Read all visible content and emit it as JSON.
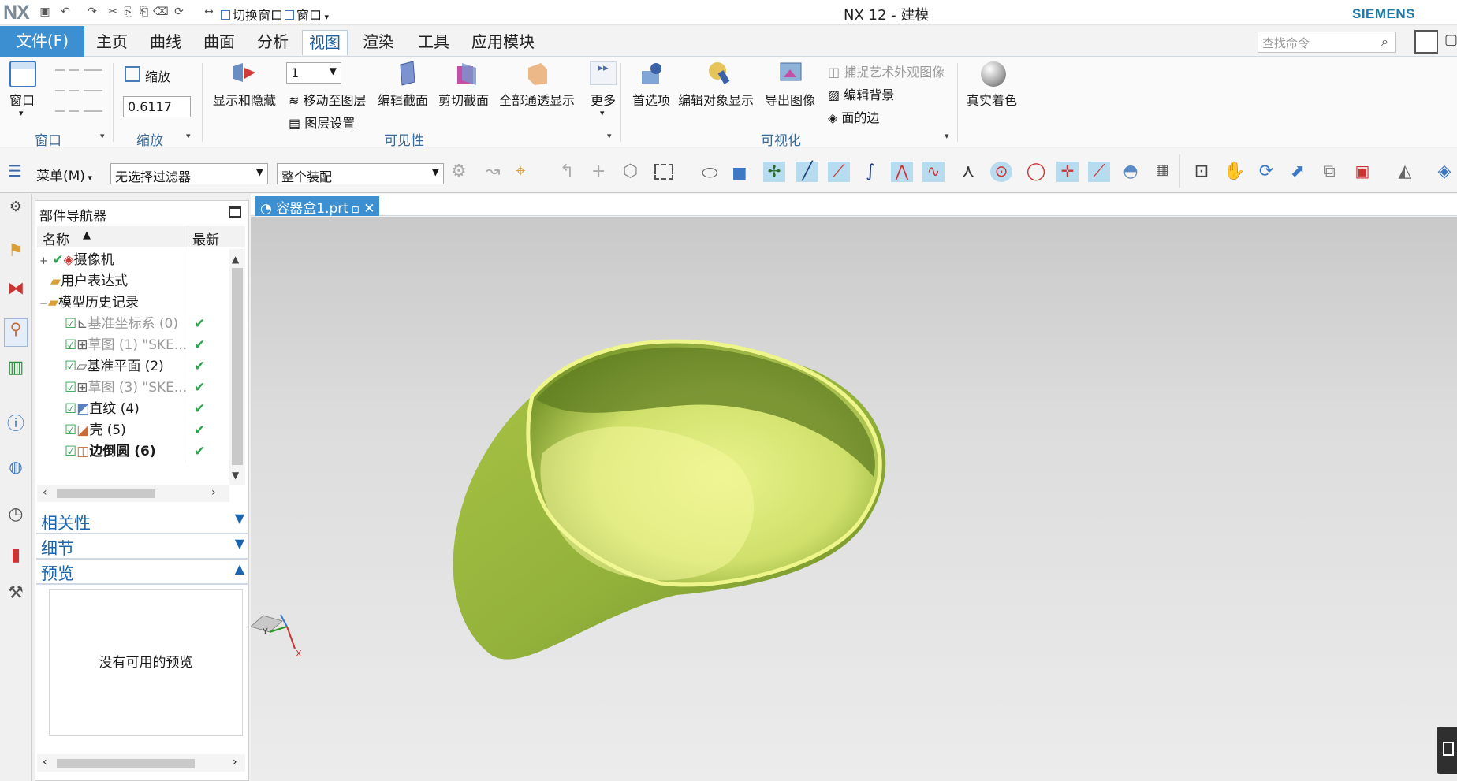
{
  "titlebar": {
    "logo": "NX",
    "title": "NX 12 - 建模",
    "brand": "SIEMENS",
    "switch_window": "切换窗口",
    "window_menu": "窗口"
  },
  "menu": {
    "file": "文件(F)",
    "tabs": [
      "主页",
      "曲线",
      "曲面",
      "分析",
      "视图",
      "渲染",
      "工具",
      "应用模块"
    ],
    "active_tab": "视图",
    "search_placeholder": "查找命令"
  },
  "ribbon": {
    "window": {
      "label": "窗口",
      "group": "窗口"
    },
    "zoom": {
      "label": "缩放",
      "value": "0.6117",
      "group": "缩放"
    },
    "visibility": {
      "show_hide": "显示和隐藏",
      "layer_value": "1",
      "move_to_layer": "移动至图层",
      "layer_settings": "图层设置",
      "edit_section": "编辑截面",
      "clip_section": "剪切截面",
      "all_see_through": "全部通透显示",
      "more": "更多",
      "group": "可见性"
    },
    "visualization": {
      "preferences": "首选项",
      "edit_object_display": "编辑对象显示",
      "export_image": "导出图像",
      "capture_art": "捕捉艺术外观图像",
      "edit_background": "编辑背景",
      "face_edges": "面的边",
      "group": "可视化"
    },
    "true_shading": "真实着色"
  },
  "toolbar": {
    "menu": "菜单(M)",
    "filter": "无选择过滤器",
    "scope": "整个装配"
  },
  "navigator": {
    "title": "部件导航器",
    "col_name": "名称",
    "col_latest": "最新",
    "items": [
      {
        "label": "摄像机",
        "indent": 0,
        "checked": false,
        "latest": ""
      },
      {
        "label": "用户表达式",
        "indent": 0,
        "checked": false,
        "latest": ""
      },
      {
        "label": "模型历史记录",
        "indent": 0,
        "checked": false,
        "latest": ""
      },
      {
        "label": "基准坐标系 (0)",
        "indent": 1,
        "checked": true,
        "latest": "✔"
      },
      {
        "label": "草图 (1) \"SKE...",
        "indent": 1,
        "checked": true,
        "latest": "✔"
      },
      {
        "label": "基准平面 (2)",
        "indent": 1,
        "checked": true,
        "latest": "✔"
      },
      {
        "label": "草图 (3) \"SKE...",
        "indent": 1,
        "checked": true,
        "latest": "✔"
      },
      {
        "label": "直纹 (4)",
        "indent": 1,
        "checked": true,
        "latest": "✔"
      },
      {
        "label": "壳 (5)",
        "indent": 1,
        "checked": true,
        "latest": "✔"
      },
      {
        "label": "边倒圆 (6)",
        "indent": 1,
        "checked": true,
        "latest": "✔"
      }
    ],
    "dependencies": "相关性",
    "details": "细节",
    "preview": "预览",
    "no_preview": "没有可用的预览"
  },
  "viewport": {
    "tab": "容器盒1.prt",
    "model_color": "#9cb83a",
    "rim_color": "#eef58a"
  }
}
